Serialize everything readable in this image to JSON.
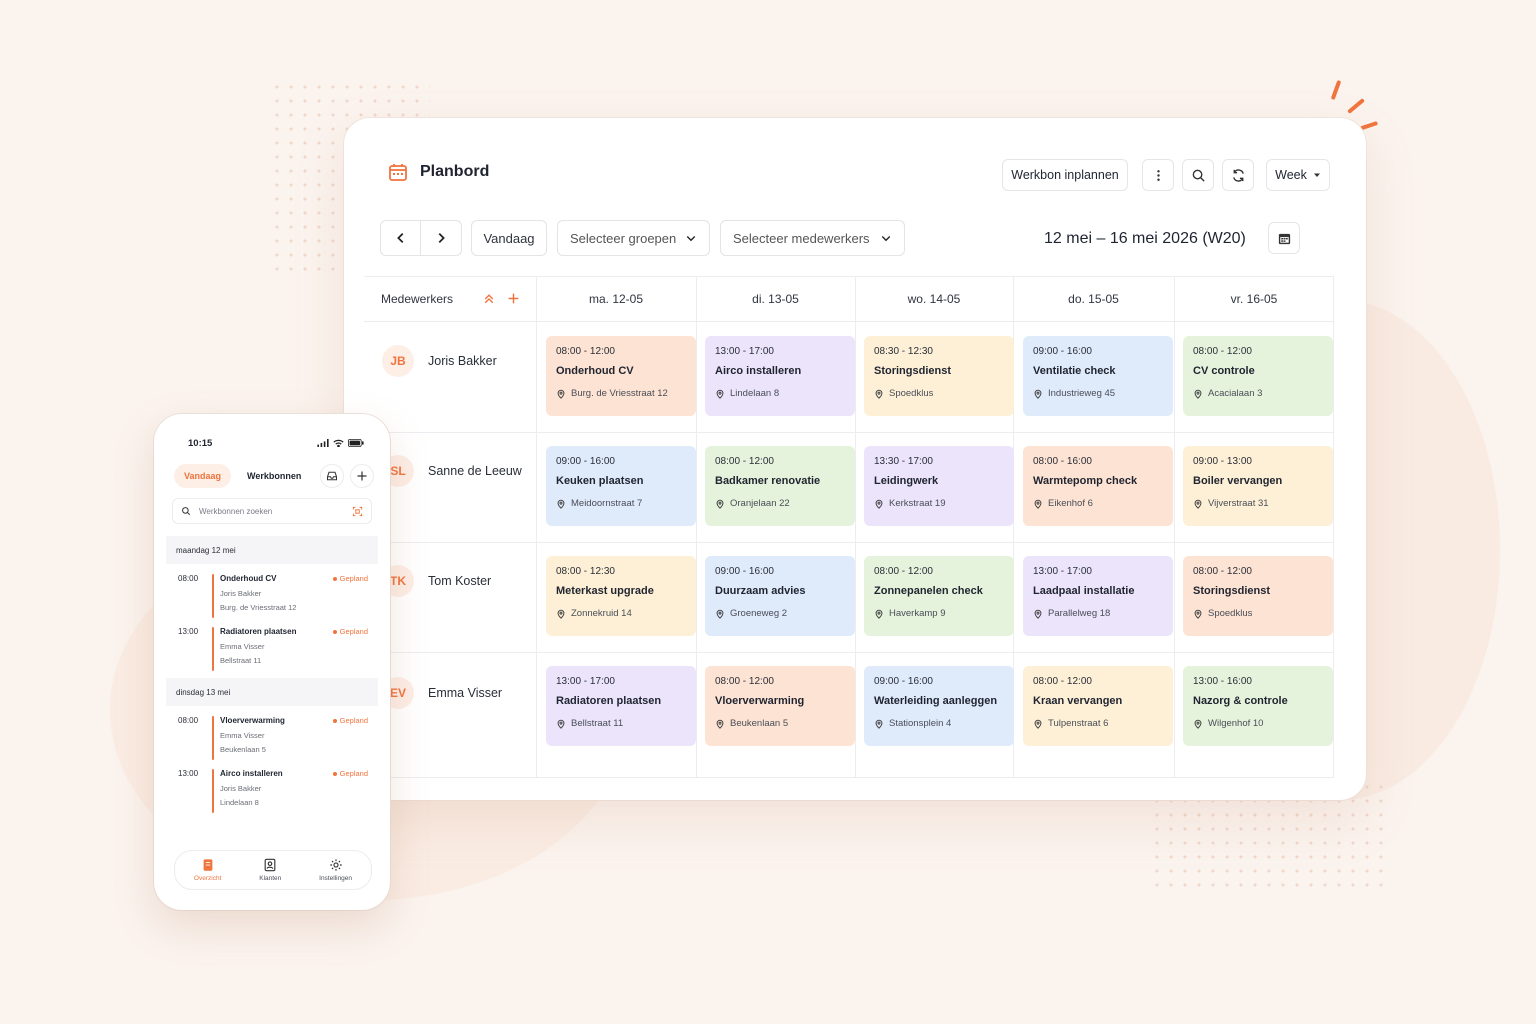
{
  "app": {
    "title": "Planbord"
  },
  "toolbar": {
    "schedule_label": "Werkbon inplannen",
    "view_label": "Week"
  },
  "nav": {
    "today_label": "Vandaag",
    "groups_placeholder": "Selecteer groepen",
    "employees_placeholder": "Selecteer medewerkers",
    "date_range": "12 mei – 16 mei 2026 (W20)"
  },
  "grid": {
    "employees_header": "Medewerkers",
    "days": [
      "ma. 12-05",
      "di. 13-05",
      "wo. 14-05",
      "do. 15-05",
      "vr. 16-05"
    ],
    "rows": [
      {
        "initials": "JB",
        "name": "Joris Bakker",
        "jobs": [
          {
            "time": "08:00 - 12:00",
            "title": "Onderhoud CV",
            "address": "Burg. de Vriesstraat 12",
            "color": "#fde3d3"
          },
          {
            "time": "13:00 - 17:00",
            "title": "Airco installeren",
            "address": "Lindelaan 8",
            "color": "#ebe4fb"
          },
          {
            "time": "08:30 - 12:30",
            "title": "Storingsdienst",
            "address": "Spoedklus",
            "color": "#fdf0d6"
          },
          {
            "time": "09:00 - 16:00",
            "title": "Ventilatie check",
            "address": "Industrieweg 45",
            "color": "#dfeafb"
          },
          {
            "time": "08:00 - 12:00",
            "title": "CV controle",
            "address": "Acacialaan 3",
            "color": "#e6f3dc"
          }
        ]
      },
      {
        "initials": "SL",
        "name": "Sanne de Leeuw",
        "jobs": [
          {
            "time": "09:00 - 16:00",
            "title": "Keuken plaatsen",
            "address": "Meidoornstraat 7",
            "color": "#dfeafb"
          },
          {
            "time": "08:00 - 12:00",
            "title": "Badkamer renovatie",
            "address": "Oranjelaan 22",
            "color": "#e6f3dc"
          },
          {
            "time": "13:30 - 17:00",
            "title": "Leidingwerk",
            "address": "Kerkstraat 19",
            "color": "#ebe4fb"
          },
          {
            "time": "08:00 - 16:00",
            "title": "Warmtepomp check",
            "address": "Eikenhof 6",
            "color": "#fde3d3"
          },
          {
            "time": "09:00 - 13:00",
            "title": "Boiler vervangen",
            "address": "Vijverstraat 31",
            "color": "#fdf0d6"
          }
        ]
      },
      {
        "initials": "TK",
        "name": "Tom Koster",
        "jobs": [
          {
            "time": "08:00 - 12:30",
            "title": "Meterkast upgrade",
            "address": "Zonnekruid 14",
            "color": "#fdf0d6"
          },
          {
            "time": "09:00 - 16:00",
            "title": "Duurzaam advies",
            "address": "Groeneweg 2",
            "color": "#dfeafb"
          },
          {
            "time": "08:00 - 12:00",
            "title": "Zonnepanelen check",
            "address": "Haverkamp 9",
            "color": "#e6f3dc"
          },
          {
            "time": "13:00 - 17:00",
            "title": "Laadpaal installatie",
            "address": "Parallelweg 18",
            "color": "#ebe4fb"
          },
          {
            "time": "08:00 - 12:00",
            "title": "Storingsdienst",
            "address": "Spoedklus",
            "color": "#fde3d3"
          }
        ]
      },
      {
        "initials": "EV",
        "name": "Emma Visser",
        "jobs": [
          {
            "time": "13:00 - 17:00",
            "title": "Radiatoren plaatsen",
            "address": "Bellstraat 11",
            "color": "#ebe4fb"
          },
          {
            "time": "08:00 - 12:00",
            "title": "Vloerverwarming",
            "address": "Beukenlaan 5",
            "color": "#fde3d3"
          },
          {
            "time": "09:00 - 16:00",
            "title": "Waterleiding aanleggen",
            "address": "Stationsplein 4",
            "color": "#dfeafb"
          },
          {
            "time": "08:00 - 12:00",
            "title": "Kraan vervangen",
            "address": "Tulpenstraat 6",
            "color": "#fdf0d6"
          },
          {
            "time": "13:00 - 16:00",
            "title": "Nazorg & controle",
            "address": "Wilgenhof 10",
            "color": "#e6f3dc"
          }
        ]
      }
    ]
  },
  "phone": {
    "time": "10:15",
    "tab_today": "Vandaag",
    "tab_orders": "Werkbonnen",
    "search_placeholder": "Werkbonnen zoeken",
    "days": [
      {
        "label": "maandag 12 mei",
        "items": [
          {
            "time": "08:00",
            "title": "Onderhoud CV",
            "person": "Joris Bakker",
            "address": "Burg. de Vriesstraat 12",
            "status": "Gepland"
          },
          {
            "time": "13:00",
            "title": "Radiatoren plaatsen",
            "person": "Emma Visser",
            "address": "Bellstraat 11",
            "status": "Gepland"
          }
        ]
      },
      {
        "label": "dinsdag 13 mei",
        "items": [
          {
            "time": "08:00",
            "title": "Vloerverwarming",
            "person": "Emma Visser",
            "address": "Beukenlaan 5",
            "status": "Gepland"
          },
          {
            "time": "13:00",
            "title": "Airco installeren",
            "person": "Joris Bakker",
            "address": "Lindelaan 8",
            "status": "Gepland"
          }
        ]
      }
    ],
    "nav": [
      "Overzicht",
      "Klanten",
      "Instellingen"
    ]
  },
  "colors": {
    "accent": "#f0743e"
  }
}
